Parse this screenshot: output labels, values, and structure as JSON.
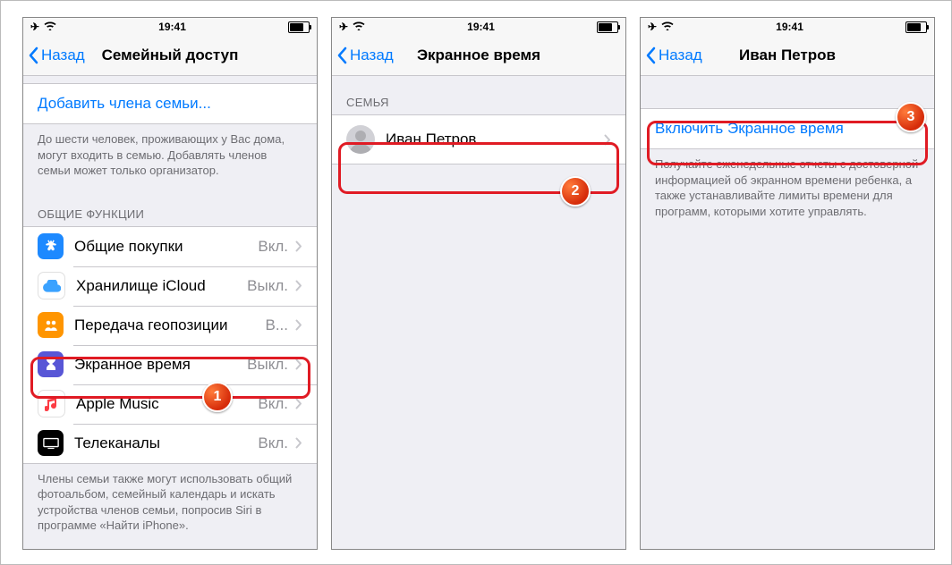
{
  "status": {
    "time": "19:41"
  },
  "nav": {
    "back": "Назад"
  },
  "screen1": {
    "title": "Семейный доступ",
    "add_member": "Добавить члена семьи...",
    "add_footer": "До шести человек, проживающих у Вас дома, могут входить в семью. Добавлять членов семьи может только организатор.",
    "shared_header": "ОБЩИЕ ФУНКЦИИ",
    "rows": [
      {
        "label": "Общие покупки",
        "value": "Вкл."
      },
      {
        "label": "Хранилище iCloud",
        "value": "Выкл."
      },
      {
        "label": "Передача геопозиции",
        "value": "В..."
      },
      {
        "label": "Экранное время",
        "value": "Выкл."
      },
      {
        "label": "Apple Music",
        "value": "Вкл."
      },
      {
        "label": "Телеканалы",
        "value": "Вкл."
      }
    ],
    "shared_footer": "Члены семьи также могут использовать общий фотоальбом, семейный календарь и искать устройства членов семьи, попросив Siri в программе «Найти iPhone»."
  },
  "screen2": {
    "title": "Экранное время",
    "family_header": "СЕМЬЯ",
    "member": "Иван Петров"
  },
  "screen3": {
    "title": "Иван Петров",
    "enable": "Включить Экранное время",
    "footer": "Получайте еженедельные отчеты с достоверной информацией об экранном времени ребенка, а также устанавливайте лимиты времени для программ, которыми хотите управлять."
  },
  "badges": {
    "b1": "1",
    "b2": "2",
    "b3": "3"
  }
}
